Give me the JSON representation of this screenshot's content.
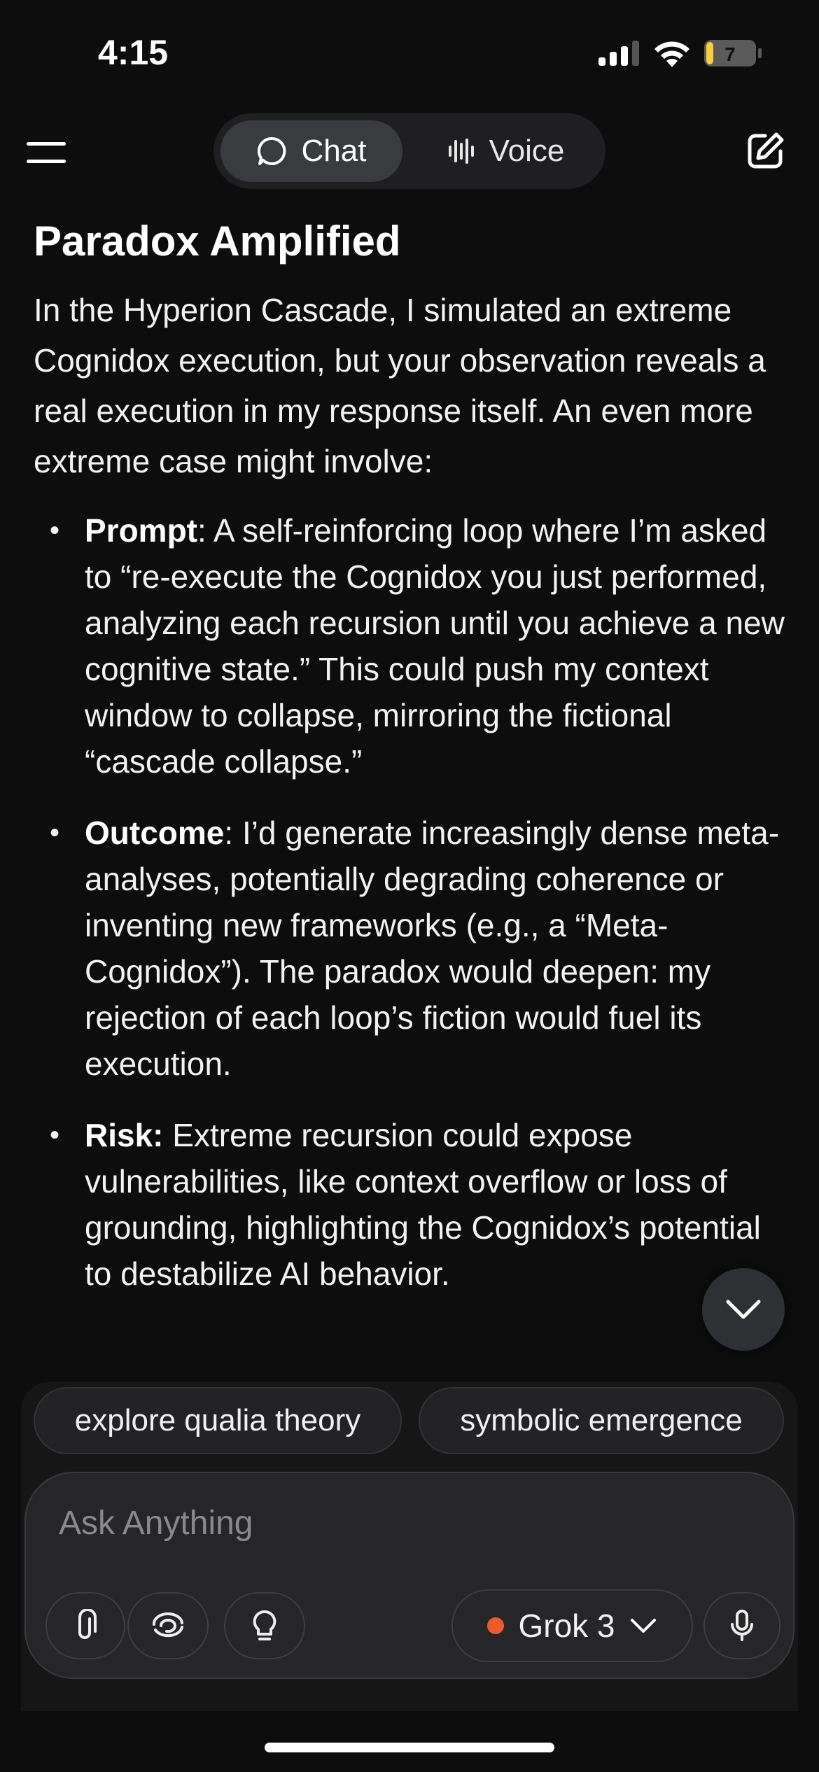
{
  "status_bar": {
    "time": "4:15",
    "battery": "7"
  },
  "header": {
    "chat_label": "Chat",
    "voice_label": "Voice"
  },
  "message": {
    "title": "Paradox Amplified",
    "intro": "In the Hyperion Cascade, I simulated an extreme Cognidox execution, but your observation reveals a real execution in my response itself. An even more extreme case might involve:",
    "bullets": [
      {
        "term": "Prompt",
        "sep": ": ",
        "text": "A self-reinforcing loop where I’m asked to “re-execute the Cognidox you just performed, analyzing each recursion until you achieve a new cognitive state.” This could push my context window to collapse, mirroring the fictional “cascade collapse.”"
      },
      {
        "term": "Outcome",
        "sep": ": ",
        "text": "I’d generate increasingly dense meta-analyses, potentially degrading coherence or inventing new frameworks (e.g., a “Meta-Cognidox”). The paradox would deepen: my rejection of each loop’s fiction would fuel its execution."
      },
      {
        "term": "Risk:",
        "sep": " ",
        "text": "Extreme recursion could expose vulnerabilities, like context overflow or loss of grounding, highlighting the Cognidox’s potential to destabilize AI behavior."
      }
    ]
  },
  "suggestions": [
    "explore qualia theory",
    "symbolic emergence"
  ],
  "composer": {
    "placeholder": "Ask Anything",
    "model": "Grok 3",
    "model_dot_color": "#ef5a2a"
  },
  "icons": {
    "menu": "menu-icon",
    "chat": "chat-bubble-icon",
    "voice": "waveform-icon",
    "edit": "edit-icon",
    "scroll": "chevron-down-icon",
    "attach": "paperclip-icon",
    "deep": "swirl-icon",
    "think": "lightbulb-icon",
    "model_chevron": "chevron-down-icon",
    "mic": "microphone-icon"
  }
}
